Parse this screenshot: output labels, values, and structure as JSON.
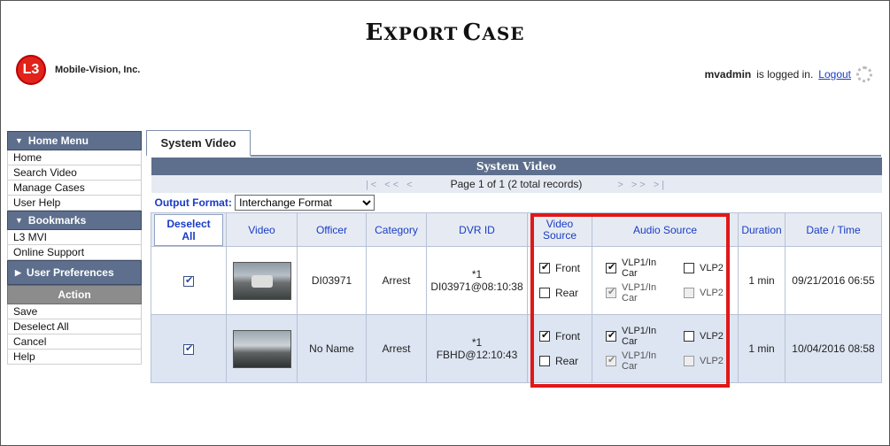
{
  "header": {
    "title_first_big": "E",
    "title_first_small": "XPORT",
    "title_second_big": "C",
    "title_second_small": "ASE",
    "logo_badge": "L3",
    "logo_text": "Mobile-Vision, Inc.",
    "username": "mvadmin",
    "logged_in_text": "is logged in.",
    "logout_label": "Logout"
  },
  "sidebar": {
    "home_menu": "Home Menu",
    "home_items": [
      "Home",
      "Search Video",
      "Manage Cases",
      "User Help"
    ],
    "bookmarks": "Bookmarks",
    "bookmark_items": [
      "L3 MVI",
      "Online Support"
    ],
    "user_prefs": "User Preferences",
    "action": "Action",
    "action_items": [
      "Save",
      "Deselect All",
      "Cancel",
      "Help"
    ]
  },
  "tab": {
    "label": "System Video"
  },
  "table": {
    "caption": "System Video",
    "pager_buttons_left": "|< << <",
    "pager_text": "Page 1 of 1 (2 total records)",
    "pager_buttons_right": "> >> >|",
    "output_format_label": "Output Format:",
    "output_format_value": "Interchange Format",
    "columns": {
      "deselect": "Deselect All",
      "video": "Video",
      "officer": "Officer",
      "category": "Category",
      "dvr_id": "DVR ID",
      "video_source_1": "Video",
      "video_source_2": "Source",
      "audio_source": "Audio Source",
      "duration": "Duration",
      "datetime": "Date / Time"
    },
    "rows": [
      {
        "officer": "DI03971",
        "category": "Arrest",
        "dvr_line1": "*1",
        "dvr_line2": "DI03971@08:10:38",
        "front": "Front",
        "rear": "Rear",
        "audio_a1": "VLP1/In",
        "audio_a2": "Car",
        "audio_b": "VLP2",
        "audio_c1": "VLP1/In",
        "audio_c2": "Car",
        "audio_d": "VLP2",
        "duration": "1 min",
        "datetime": "09/21/2016 06:55"
      },
      {
        "officer": "No Name",
        "category": "Arrest",
        "dvr_line1": "*1",
        "dvr_line2": "FBHD@12:10:43",
        "front": "Front",
        "rear": "Rear",
        "audio_a1": "VLP1/In",
        "audio_a2": "Car",
        "audio_b": "VLP2",
        "audio_c1": "VLP1/In",
        "audio_c2": "Car",
        "audio_d": "VLP2",
        "duration": "1 min",
        "datetime": "10/04/2016 08:58"
      }
    ]
  }
}
